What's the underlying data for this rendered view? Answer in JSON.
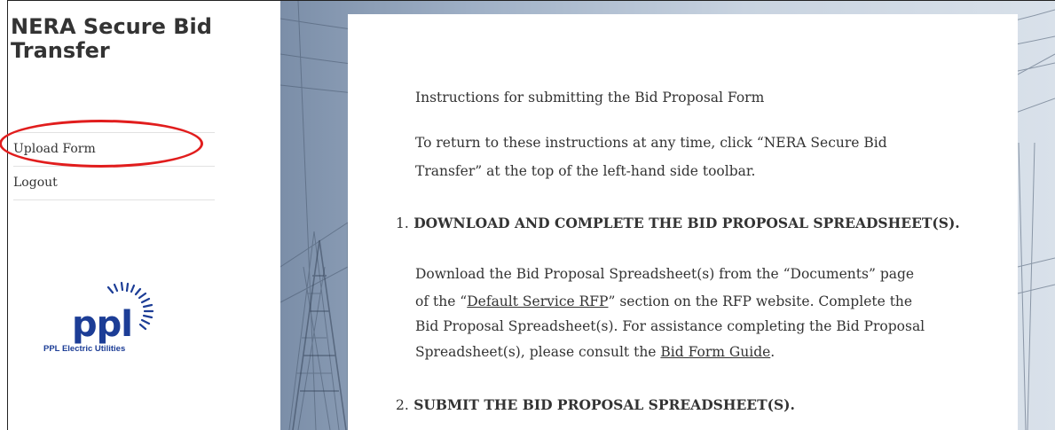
{
  "sidebar": {
    "site_title": "NERA Secure Bid Transfer",
    "nav": [
      {
        "label": "Upload Form"
      },
      {
        "label": "Logout"
      }
    ],
    "logo": {
      "text": "ppl",
      "subtitle": "PPL Electric Utilities"
    }
  },
  "content": {
    "heading": "Instructions for submitting the Bid Proposal Form",
    "return_note": {
      "line1": "To return to these instructions at any time, click “NERA Secure Bid",
      "line2": "Transfer” at the top of the left-hand side toolbar."
    },
    "steps": [
      {
        "number": "1.",
        "title": "DOWNLOAD AND COMPLETE THE BID PROPOSAL SPREADSHEET(S)."
      },
      {
        "number": "2.",
        "title": "SUBMIT THE BID PROPOSAL SPREADSHEET(S)."
      }
    ],
    "step1_body": {
      "line1": "Download the Bid Proposal Spreadsheet(s) from the “Documents” page",
      "line2_pre": "of the “",
      "line2_link": "Default Service RFP",
      "line2_post": "” section on the RFP website. Complete the",
      "line3": "Bid Proposal Spreadsheet(s).  For assistance completing the Bid Proposal",
      "line4_pre": "Spreadsheet(s), please consult the ",
      "line4_link": "Bid Form Guide",
      "line4_post": "."
    }
  },
  "colors": {
    "annotation": "#e11d1d",
    "logo_blue": "#1c3d96",
    "text": "#333333"
  }
}
